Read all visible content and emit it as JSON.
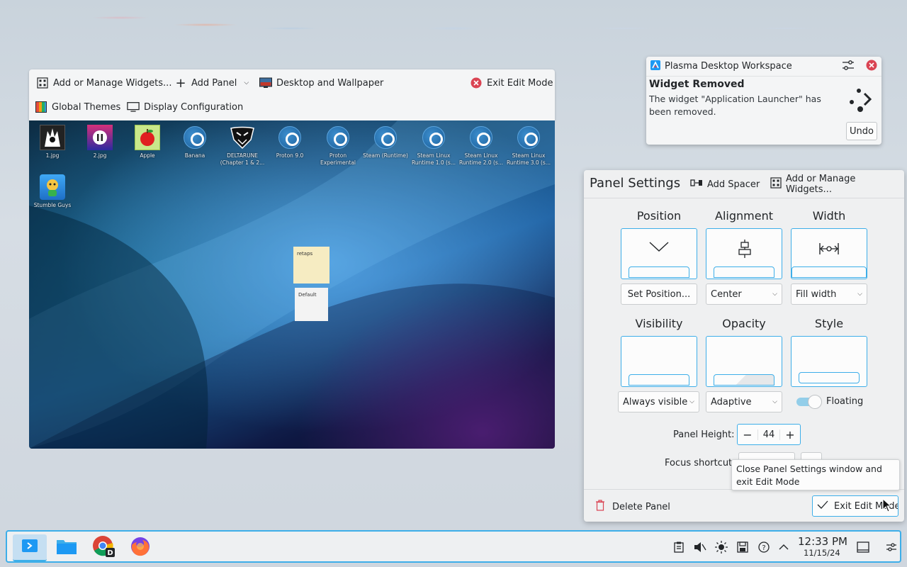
{
  "edit_toolbar": {
    "add_widgets": "Add or Manage Widgets...",
    "add_panel": "Add Panel",
    "desktop_wallpaper": "Desktop and Wallpaper",
    "exit_edit_mode": "Exit Edit Mode",
    "global_themes": "Global Themes",
    "display_configuration": "Display Configuration"
  },
  "desktop": {
    "icons": [
      {
        "label": "1.jpg",
        "icon": "image-thumbnail-icon"
      },
      {
        "label": "2.jpg",
        "icon": "image-thumbnail-icon"
      },
      {
        "label": "Apple",
        "icon": "apple-icon"
      },
      {
        "label": "Banana",
        "icon": "steam-icon"
      },
      {
        "label": "DELTARUNE (Chapter 1 & 2...",
        "icon": "deltarune-icon"
      },
      {
        "label": "Proton 9.0",
        "icon": "steam-icon"
      },
      {
        "label": "Proton Experimental",
        "icon": "steam-icon"
      },
      {
        "label": "Steam (Runtime)",
        "icon": "steam-icon"
      },
      {
        "label": "Steam Linux Runtime 1.0 (s...",
        "icon": "steam-icon"
      },
      {
        "label": "Steam Linux Runtime 2.0 (s...",
        "icon": "steam-icon"
      },
      {
        "label": "Steam Linux Runtime 3.0 (s...",
        "icon": "steam-icon"
      },
      {
        "label": "Stumble Guys",
        "icon": "stumble-guys-icon"
      }
    ],
    "notes": [
      "retaps",
      "Default"
    ]
  },
  "notification": {
    "app": "Plasma Desktop Workspace",
    "title": "Widget Removed",
    "body": "The widget \"Application Launcher\" has been removed.",
    "undo": "Undo"
  },
  "panel_settings": {
    "title": "Panel Settings",
    "add_spacer": "Add Spacer",
    "add_widgets": "Add or Manage Widgets...",
    "position_label": "Position",
    "alignment_label": "Alignment",
    "width_label": "Width",
    "set_position": "Set Position...",
    "alignment_value": "Center",
    "width_value": "Fill width",
    "visibility_label": "Visibility",
    "opacity_label": "Opacity",
    "style_label": "Style",
    "visibility_value": "Always visible",
    "opacity_value": "Adaptive",
    "floating_label": "Floating",
    "floating_on": true,
    "panel_height_label": "Panel Height:",
    "panel_height_value": "44",
    "focus_shortcut_label": "Focus shortcut:",
    "delete_panel": "Delete Panel",
    "exit_edit_mode": "Exit Edit Mode",
    "tooltip": "Close Panel Settings window and exit Edit Mode"
  },
  "taskbar": {
    "apps": [
      "discover-icon",
      "dolphin-folder-icon",
      "chrome-icon",
      "firefox-icon"
    ],
    "time": "12:33 PM",
    "date": "11/15/24"
  },
  "colors": {
    "accent": "#3daee9",
    "close_red": "#da4453"
  }
}
